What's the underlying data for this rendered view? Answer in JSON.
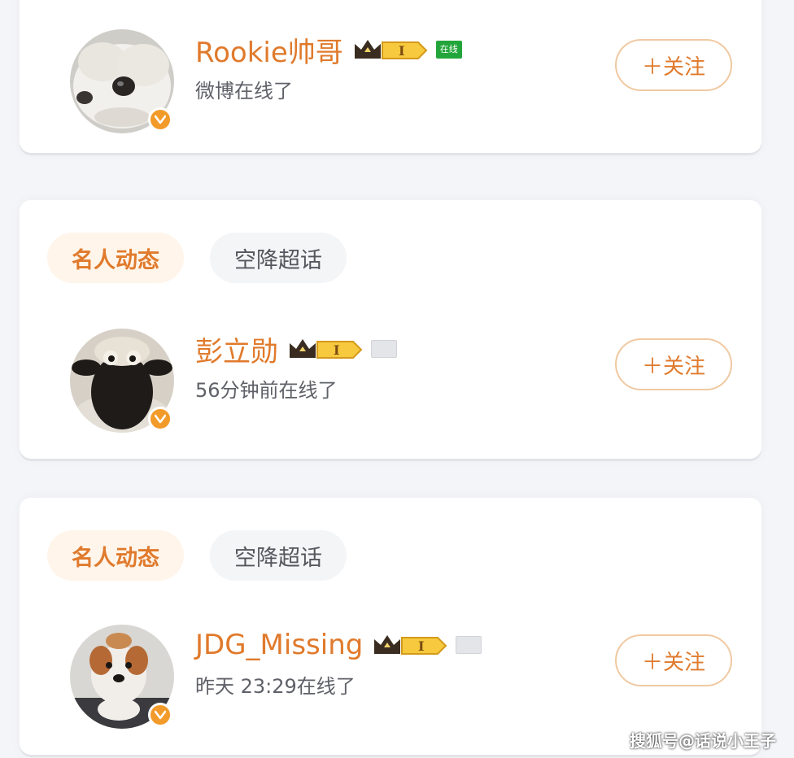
{
  "colors": {
    "accent": "#e07a2c",
    "online_green": "#22a53a",
    "badge_orange": "#f29a2a"
  },
  "users": [
    {
      "username": "Rookie帅哥",
      "vip_level": "I",
      "online_tag": "在线",
      "status": "微博在线了",
      "follow_label": "＋关注",
      "avatar_icon": "white-dog-avatar"
    },
    {
      "username": "彭立勋",
      "vip_level": "I",
      "status": "56分钟前在线了",
      "follow_label": "＋关注",
      "avatar_icon": "cartoon-sheep-avatar"
    },
    {
      "username": "JDG_Missing",
      "vip_level": "I",
      "status": "昨天 23:29在线了",
      "follow_label": "＋关注",
      "avatar_icon": "corgi-dog-avatar"
    }
  ],
  "sections": [
    {
      "tabs": [
        "名人动态",
        "空降超话"
      ],
      "active_tab": "名人动态"
    },
    {
      "tabs": [
        "名人动态",
        "空降超话"
      ],
      "active_tab": "名人动态"
    }
  ],
  "watermark": "搜狐号@话说小王子"
}
